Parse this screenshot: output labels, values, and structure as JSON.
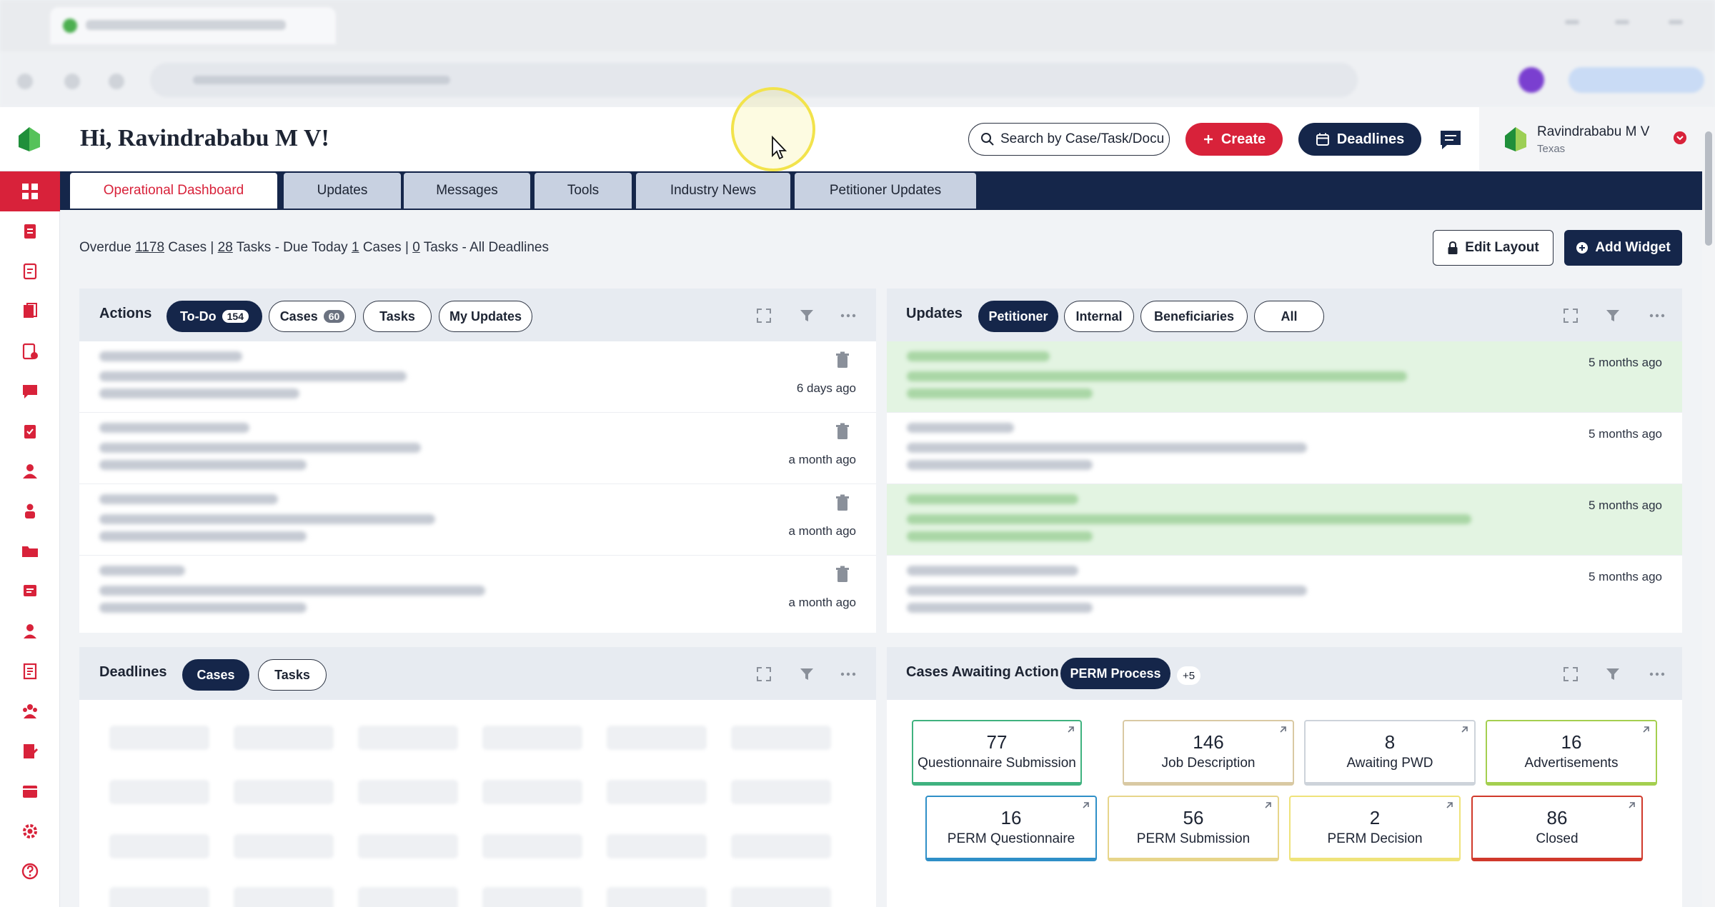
{
  "header": {
    "greeting": "Hi, Ravindrababu M V!",
    "search_placeholder": "Search by Case/Task/Document",
    "create_label": "Create",
    "deadlines_label": "Deadlines",
    "user_name": "Ravindrababu M V",
    "user_location": "Texas"
  },
  "tabs": [
    {
      "label": "Operational Dashboard",
      "active": true
    },
    {
      "label": "Updates"
    },
    {
      "label": "Messages"
    },
    {
      "label": "Tools"
    },
    {
      "label": "Industry News"
    },
    {
      "label": "Petitioner Updates"
    }
  ],
  "summary": {
    "overdue_label": "Overdue",
    "overdue_cases": "1178",
    "cases_word": "Cases |",
    "overdue_tasks": "28",
    "tasks_due_label": "Tasks - Due Today",
    "due_cases": "1",
    "due_cases_word": "Cases |",
    "due_tasks": "0",
    "all_label": "Tasks - All Deadlines"
  },
  "toolbar": {
    "edit_layout": "Edit Layout",
    "add_widget": "Add Widget"
  },
  "actions_widget": {
    "title": "Actions",
    "filters": [
      {
        "label": "To-Do",
        "count": "154",
        "selected": true
      },
      {
        "label": "Cases",
        "count": "60"
      },
      {
        "label": "Tasks"
      },
      {
        "label": "My Updates"
      }
    ],
    "items": [
      {
        "time": "6 days ago"
      },
      {
        "time": "a month ago"
      },
      {
        "time": "a month ago"
      },
      {
        "time": "a month ago"
      }
    ]
  },
  "updates_widget": {
    "title": "Updates",
    "filters": [
      {
        "label": "Petitioner",
        "selected": true
      },
      {
        "label": "Internal"
      },
      {
        "label": "Beneficiaries"
      },
      {
        "label": "All"
      }
    ],
    "items": [
      {
        "time": "5 months ago",
        "highlight": true
      },
      {
        "time": "5 months ago",
        "highlight": false
      },
      {
        "time": "5 months ago",
        "highlight": true
      },
      {
        "time": "5 months ago",
        "highlight": false
      }
    ]
  },
  "deadlines_widget": {
    "title": "Deadlines",
    "filters": [
      {
        "label": "Cases",
        "selected": true
      },
      {
        "label": "Tasks"
      }
    ]
  },
  "awaiting_widget": {
    "title": "Cases Awaiting Action",
    "process_label": "PERM Process",
    "more_label": "+5",
    "stats": [
      {
        "value": "77",
        "label": "Questionnaire Submission",
        "color": "#3fb27f"
      },
      {
        "value": "146",
        "label": "Job Description",
        "color": "#d9c9a3"
      },
      {
        "value": "8",
        "label": "Awaiting PWD",
        "color": "#cdd3da"
      },
      {
        "value": "16",
        "label": "Advertisements",
        "color": "#a4cf4f"
      },
      {
        "value": "16",
        "label": "PERM Questionnaire",
        "color": "#2f8fc7"
      },
      {
        "value": "56",
        "label": "PERM Submission",
        "color": "#e7d58a"
      },
      {
        "value": "2",
        "label": "PERM Decision",
        "color": "#efe37a"
      },
      {
        "value": "86",
        "label": "Closed",
        "color": "#d0392b"
      }
    ]
  },
  "colors": {
    "brand_red": "#d8223a",
    "navy": "#15264a",
    "highlight_green": "#e3f4e2"
  },
  "rail_icons": [
    "dashboard-icon",
    "cases-icon",
    "forms-icon",
    "documents-icon",
    "tasks-icon",
    "messages-icon",
    "clipboard-icon",
    "beneficiary-icon",
    "user-icon",
    "folder-icon",
    "notes-icon",
    "contact-icon",
    "report-icon",
    "team-icon",
    "edit-doc-icon",
    "calendar-icon",
    "settings-icon",
    "help-icon"
  ]
}
